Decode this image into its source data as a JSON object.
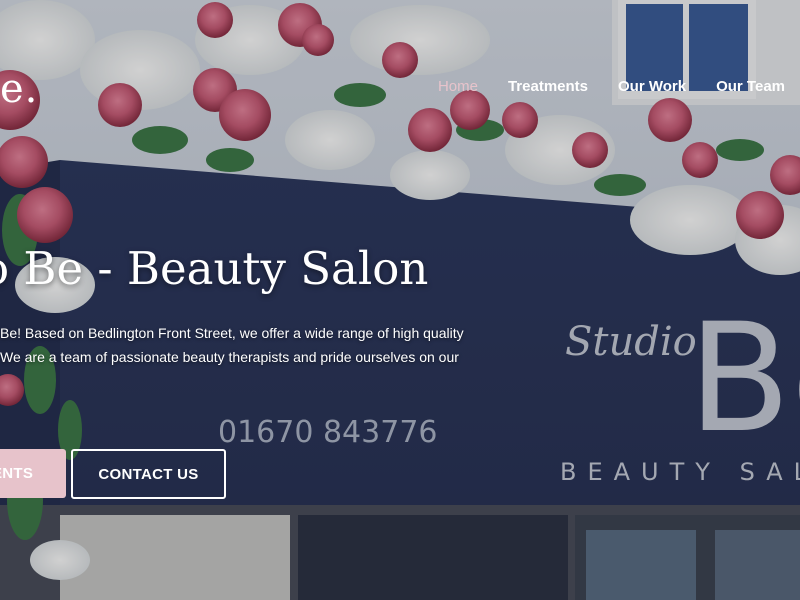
{
  "site": {
    "logo_fragment": "e."
  },
  "nav": {
    "items": [
      {
        "label": "Home",
        "active": true
      },
      {
        "label": "Treatments"
      },
      {
        "label": "Our Work"
      },
      {
        "label": "Our Team"
      }
    ]
  },
  "hero": {
    "title": "o Be - Beauty Salon",
    "intro_lines": [
      "Be! Based on Bedlington Front Street, we offer a wide range of high quality",
      "We are a team of passionate beauty therapists and pride ourselves on our"
    ],
    "buttons": {
      "treatments": "ENTS",
      "contact": "CONTACT US"
    },
    "signage": {
      "studio": "Studio",
      "be": "Be",
      "beauty_salon": "BEAUTY SAL",
      "phone": "01670 843776"
    }
  },
  "colors": {
    "accent_pink": "#e7c3cb",
    "awning_navy": "#2f3d66"
  }
}
